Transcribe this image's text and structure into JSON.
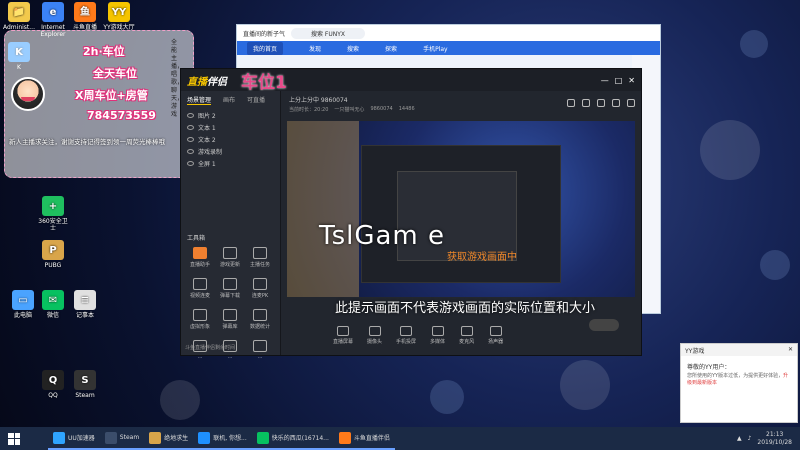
{
  "desktop": {
    "icons": [
      {
        "label": "Administ...",
        "color": "#f2c94c",
        "glyph": "📁"
      },
      {
        "label": "Internet Explorer",
        "color": "#3b82f6",
        "glyph": "e"
      },
      {
        "label": "斗鱼直播",
        "color": "#ff7a1a",
        "glyph": "鱼"
      },
      {
        "label": "YY游戏大厅",
        "color": "#f5c400",
        "glyph": "YY"
      },
      {
        "label": "K",
        "color": "#1e90ff",
        "glyph": "K"
      },
      {
        "label": "360安全卫士",
        "color": "#1fbf5f",
        "glyph": "+"
      },
      {
        "label": "PUBG",
        "color": "#d9a54a",
        "glyph": "P"
      },
      {
        "label": "微信",
        "color": "#07c160",
        "glyph": "✉"
      },
      {
        "label": "记事本",
        "color": "#e0e0e0",
        "glyph": "≡"
      },
      {
        "label": "此电脑",
        "color": "#4aa3ff",
        "glyph": "▭"
      },
      {
        "label": "Steam",
        "color": "#333",
        "glyph": "S"
      },
      {
        "label": "QQ",
        "color": "#222",
        "glyph": "Q"
      }
    ]
  },
  "overlay": {
    "line1": "2h·车位",
    "line2": "全天车位",
    "line3": "X周车位+房管",
    "line4": "784573559",
    "side_text": "全能主播，唱歌，聊天，游戏",
    "scroll_text": "新人主播求关注，谢谢支持记得签到领一周荧光棒棒哦"
  },
  "bg_window": {
    "title": "直播间的新子气",
    "search": "搜索 FUNYX",
    "tabs": [
      "我的首页",
      "发现",
      "搜索",
      "探索",
      "手机Play"
    ],
    "active_tab": 0
  },
  "app": {
    "logo_a": "直播",
    "logo_b": "伴侣",
    "car_label": "车位1",
    "left_tabs": [
      "场景管理",
      "画布",
      "可直播"
    ],
    "sources": [
      "图片 2",
      "文本 1",
      "文本 2",
      "游戏录制",
      "全屏 1"
    ],
    "tools_title": "工具箱",
    "tools": [
      "直播助手",
      "游戏更新",
      "主播任务",
      "视频连麦",
      "弹幕下载",
      "连麦PK",
      "虚拟形象",
      "弹幕库",
      "数据统计",
      "...",
      "...",
      "..."
    ],
    "room_line": "上分上分中 9860074",
    "sub_line": [
      "当前时长：20:20",
      "一只猫叫无心",
      "9860074",
      "14486"
    ],
    "watermark": "TslGam e",
    "watermark2": "获取游戏画面中",
    "hint": "此提示画面不代表游戏画面的实际位置和大小",
    "bottom_tools": [
      "直播屏幕",
      "摄像头",
      "手机投屏",
      "多媒体",
      "麦克风",
      "扬声器"
    ],
    "live_time": "斗鱼直播伴侣剩余时间"
  },
  "notification": {
    "header": "YY游戏",
    "title": "尊敬的YY用户：",
    "body1": "您所使用的YY版本过低，",
    "body2": "为提供更好体验，",
    "link": "升级到最新版本"
  },
  "taskbar": {
    "items": [
      {
        "label": "UU加速器",
        "color": "#2fa4ff"
      },
      {
        "label": "Steam",
        "color": "#3b4d6b"
      },
      {
        "label": "绝地求生",
        "color": "#d9a54a"
      },
      {
        "label": "联机, 你想...",
        "color": "#1e90ff"
      },
      {
        "label": "快乐的西瓜(16714...",
        "color": "#07c160"
      },
      {
        "label": "斗鱼直播伴侣",
        "color": "#ff7a1a"
      }
    ],
    "time": "21:13",
    "date": "2019/10/28",
    "room_id": "9860074"
  }
}
